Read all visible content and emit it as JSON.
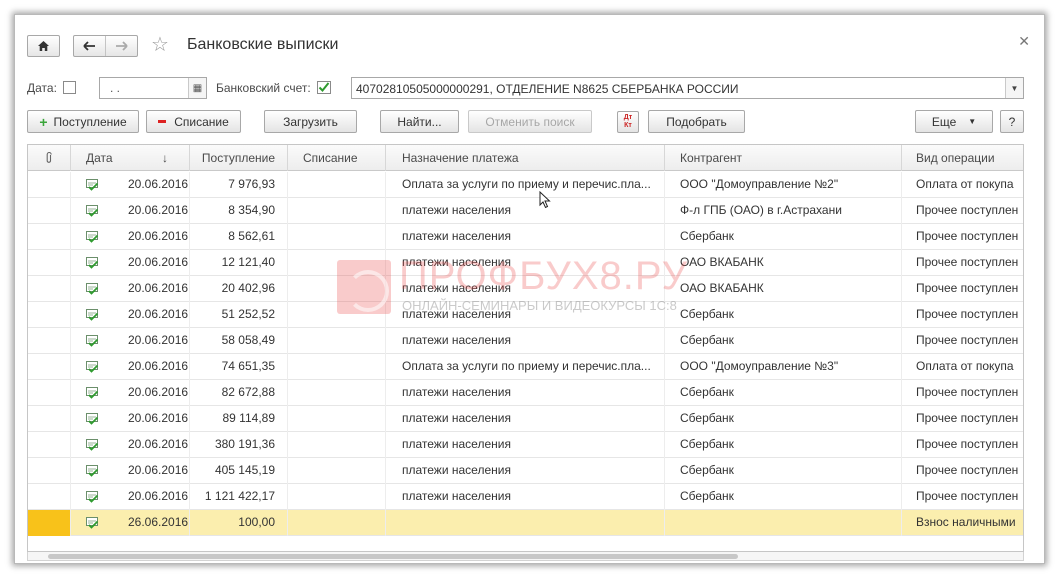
{
  "window": {
    "title": "Банковские выписки",
    "close_icon": "close-icon"
  },
  "filters": {
    "date_label": "Дата:",
    "date_checked": false,
    "date_value": " .  .",
    "account_label": "Банковский счет:",
    "account_checked": true,
    "account_value": "40702810505000000291, ОТДЕЛЕНИЕ N8625 СБЕРБАНКА РОССИИ"
  },
  "toolbar": {
    "receipt_label": "Поступление",
    "writeoff_label": "Списание",
    "load_label": "Загрузить",
    "find_label": "Найти...",
    "cancel_search_label": "Отменить поиск",
    "dtkt_label": "Дт Кт",
    "select_label": "Подобрать",
    "more_label": "Еще",
    "help_label": "?"
  },
  "columns": [
    "",
    "Дата",
    "Поступление",
    "Списание",
    "Назначение платежа",
    "Контрагент",
    "Вид операции"
  ],
  "rows": [
    {
      "date": "20.06.2016",
      "in": "7 976,93",
      "out": "",
      "purpose": "Оплата за услуги по приему и перечис.пла...",
      "counterparty": "ООО \"Домоуправление №2\"",
      "op": "Оплата от покупа"
    },
    {
      "date": "20.06.2016",
      "in": "8 354,90",
      "out": "",
      "purpose": "платежи населения",
      "counterparty": "Ф-л ГПБ (ОАО) в г.Астрахани",
      "op": "Прочее поступлен"
    },
    {
      "date": "20.06.2016",
      "in": "8 562,61",
      "out": "",
      "purpose": "платежи населения",
      "counterparty": "Сбербанк",
      "op": "Прочее поступлен"
    },
    {
      "date": "20.06.2016",
      "in": "12 121,40",
      "out": "",
      "purpose": "платежи населения",
      "counterparty": "ОАО ВКАБАНК",
      "op": "Прочее поступлен"
    },
    {
      "date": "20.06.2016",
      "in": "20 402,96",
      "out": "",
      "purpose": "платежи населения",
      "counterparty": "ОАО ВКАБАНК",
      "op": "Прочее поступлен"
    },
    {
      "date": "20.06.2016",
      "in": "51 252,52",
      "out": "",
      "purpose": "платежи населения",
      "counterparty": "Сбербанк",
      "op": "Прочее поступлен"
    },
    {
      "date": "20.06.2016",
      "in": "58 058,49",
      "out": "",
      "purpose": "платежи населения",
      "counterparty": "Сбербанк",
      "op": "Прочее поступлен"
    },
    {
      "date": "20.06.2016",
      "in": "74 651,35",
      "out": "",
      "purpose": "Оплата за услуги по приему и перечис.пла...",
      "counterparty": "ООО \"Домоуправление №3\"",
      "op": "Оплата от покупа"
    },
    {
      "date": "20.06.2016",
      "in": "82 672,88",
      "out": "",
      "purpose": "платежи населения",
      "counterparty": "Сбербанк",
      "op": "Прочее поступлен"
    },
    {
      "date": "20.06.2016",
      "in": "89 114,89",
      "out": "",
      "purpose": "платежи населения",
      "counterparty": "Сбербанк",
      "op": "Прочее поступлен"
    },
    {
      "date": "20.06.2016",
      "in": "380 191,36",
      "out": "",
      "purpose": "платежи населения",
      "counterparty": "Сбербанк",
      "op": "Прочее поступлен"
    },
    {
      "date": "20.06.2016",
      "in": "405 145,19",
      "out": "",
      "purpose": "платежи населения",
      "counterparty": "Сбербанк",
      "op": "Прочее поступлен"
    },
    {
      "date": "20.06.2016",
      "in": "1 121 422,17",
      "out": "",
      "purpose": "платежи населения",
      "counterparty": "Сбербанк",
      "op": "Прочее поступлен"
    },
    {
      "date": "26.06.2016",
      "in": "100,00",
      "out": "",
      "purpose": "",
      "counterparty": "",
      "op": "Взнос наличными",
      "selected": true
    }
  ],
  "watermark": {
    "name": "ПРОФБУХ8.РУ",
    "subtitle": "ОНЛАЙН-СЕМИНАРЫ И ВИДЕОКУРСЫ 1С:8"
  },
  "colors": {
    "selected_row": "#fbeeae",
    "selected_marker": "#f8c21a",
    "accent_green": "#3aa53a",
    "accent_red": "#dd2222"
  }
}
